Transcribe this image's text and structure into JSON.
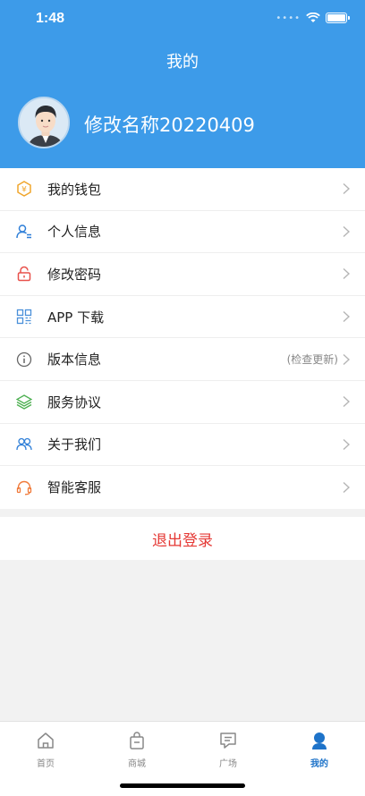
{
  "status_bar": {
    "time": "1:48"
  },
  "header": {
    "title": "我的",
    "profile_name": "修改名称20220409"
  },
  "menu": [
    {
      "label": "我的钱包",
      "icon": "wallet-icon",
      "color": "#f0a52b"
    },
    {
      "label": "个人信息",
      "icon": "person-info-icon",
      "color": "#2f7fd8"
    },
    {
      "label": "修改密码",
      "icon": "lock-icon",
      "color": "#e8504a"
    },
    {
      "label": "APP 下载",
      "icon": "qr-code-icon",
      "color": "#4a90d9"
    },
    {
      "label": "版本信息",
      "icon": "info-icon",
      "color": "#666666",
      "extra": "(检查更新)"
    },
    {
      "label": "服务协议",
      "icon": "layers-icon",
      "color": "#4caf50"
    },
    {
      "label": "关于我们",
      "icon": "users-icon",
      "color": "#2f7fd8"
    },
    {
      "label": "智能客服",
      "icon": "headset-icon",
      "color": "#f07a3a"
    }
  ],
  "logout_label": "退出登录",
  "tabs": [
    {
      "label": "首页",
      "icon": "home-icon"
    },
    {
      "label": "商城",
      "icon": "shopping-bag-icon"
    },
    {
      "label": "广场",
      "icon": "chat-icon"
    },
    {
      "label": "我的",
      "icon": "person-icon",
      "active": true
    }
  ],
  "colors": {
    "header_bg": "#3d9be9",
    "logout_text": "#e53935",
    "tab_active": "#1e73c9"
  }
}
